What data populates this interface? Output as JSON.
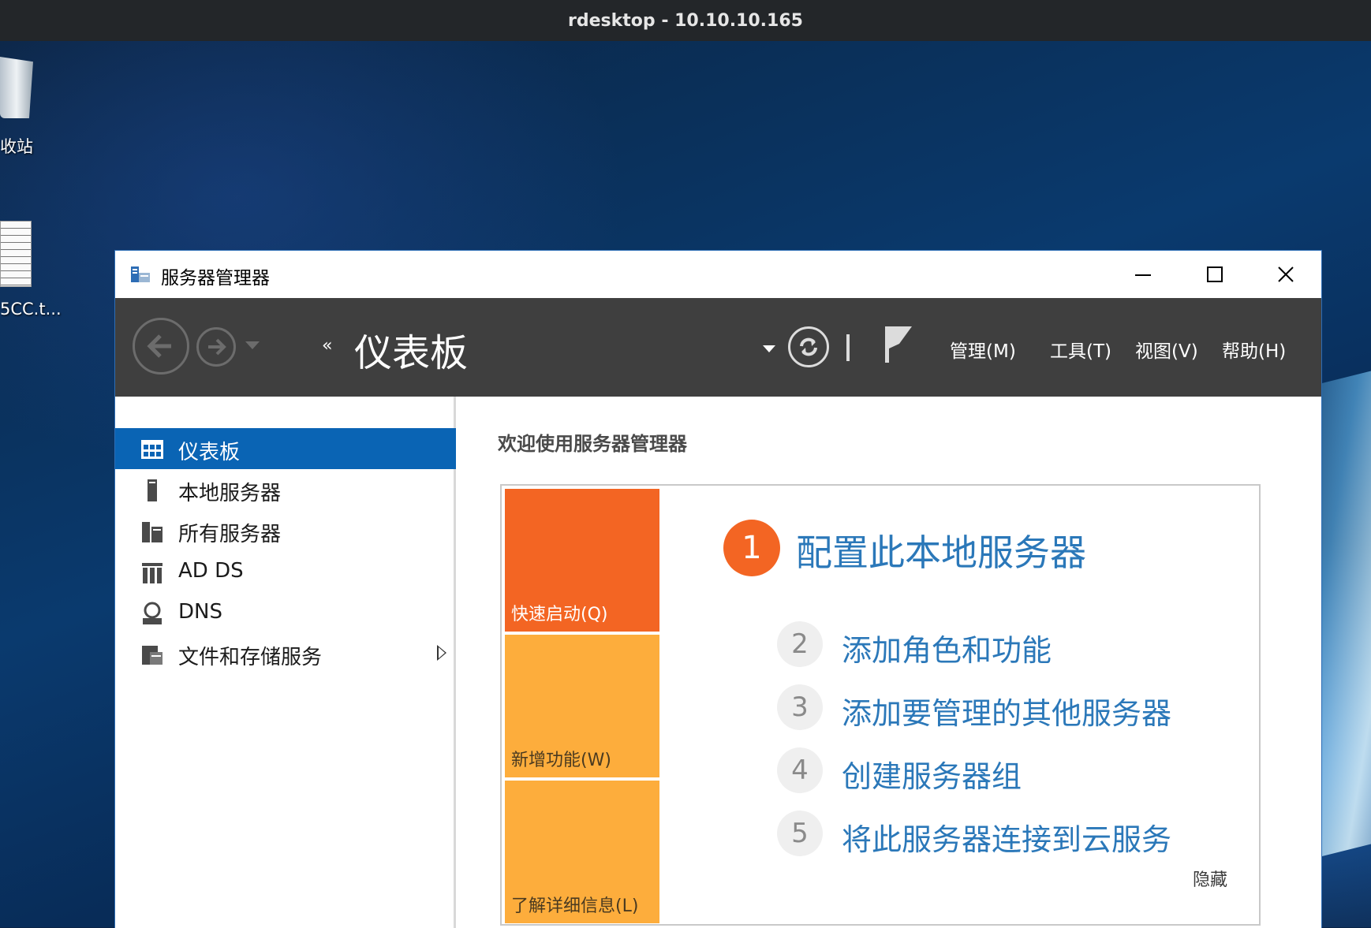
{
  "rdesktop": {
    "title": "rdesktop - 10.10.10.165"
  },
  "desktop": {
    "icons": [
      {
        "label": "收站",
        "icon": "recycle-bin-icon"
      },
      {
        "label": "5CC.t...",
        "icon": "text-file-icon"
      }
    ]
  },
  "window": {
    "title": "服务器管理器",
    "app_icon": "server-manager-icon",
    "controls": {
      "minimize": "—",
      "maximize": "☐",
      "close": "✕"
    }
  },
  "header": {
    "breadcrumb_arrows": "‹‹",
    "breadcrumb_title": "仪表板",
    "menu": [
      "管理(M)",
      "工具(T)",
      "视图(V)",
      "帮助(H)"
    ],
    "icons": [
      "back-icon",
      "forward-icon",
      "refresh-icon",
      "flag-icon"
    ]
  },
  "sidebar": {
    "items": [
      {
        "label": "仪表板",
        "icon": "dashboard-icon",
        "active": true
      },
      {
        "label": "本地服务器",
        "icon": "local-server-icon"
      },
      {
        "label": "所有服务器",
        "icon": "all-servers-icon"
      },
      {
        "label": "AD DS",
        "icon": "ad-ds-icon"
      },
      {
        "label": "DNS",
        "icon": "dns-icon"
      },
      {
        "label": "文件和存储服务",
        "icon": "file-storage-icon",
        "has_submenu": true
      }
    ]
  },
  "content": {
    "welcome": "欢迎使用服务器管理器",
    "tiles": [
      "快速启动(Q)",
      "新增功能(W)",
      "了解详细信息(L)"
    ],
    "steps": [
      {
        "num": "1",
        "label": "配置此本地服务器"
      },
      {
        "num": "2",
        "label": "添加角色和功能"
      },
      {
        "num": "3",
        "label": "添加要管理的其他服务器"
      },
      {
        "num": "4",
        "label": "创建服务器组"
      },
      {
        "num": "5",
        "label": "将此服务器连接到云服务"
      }
    ],
    "hide": "隐藏"
  },
  "colors": {
    "accent_blue": "#0a64b4",
    "header_bg": "#3f3f3f",
    "quickstart_orange": "#f36523",
    "tile_yellow": "#fdad3c",
    "link_blue": "#2b78b9"
  }
}
